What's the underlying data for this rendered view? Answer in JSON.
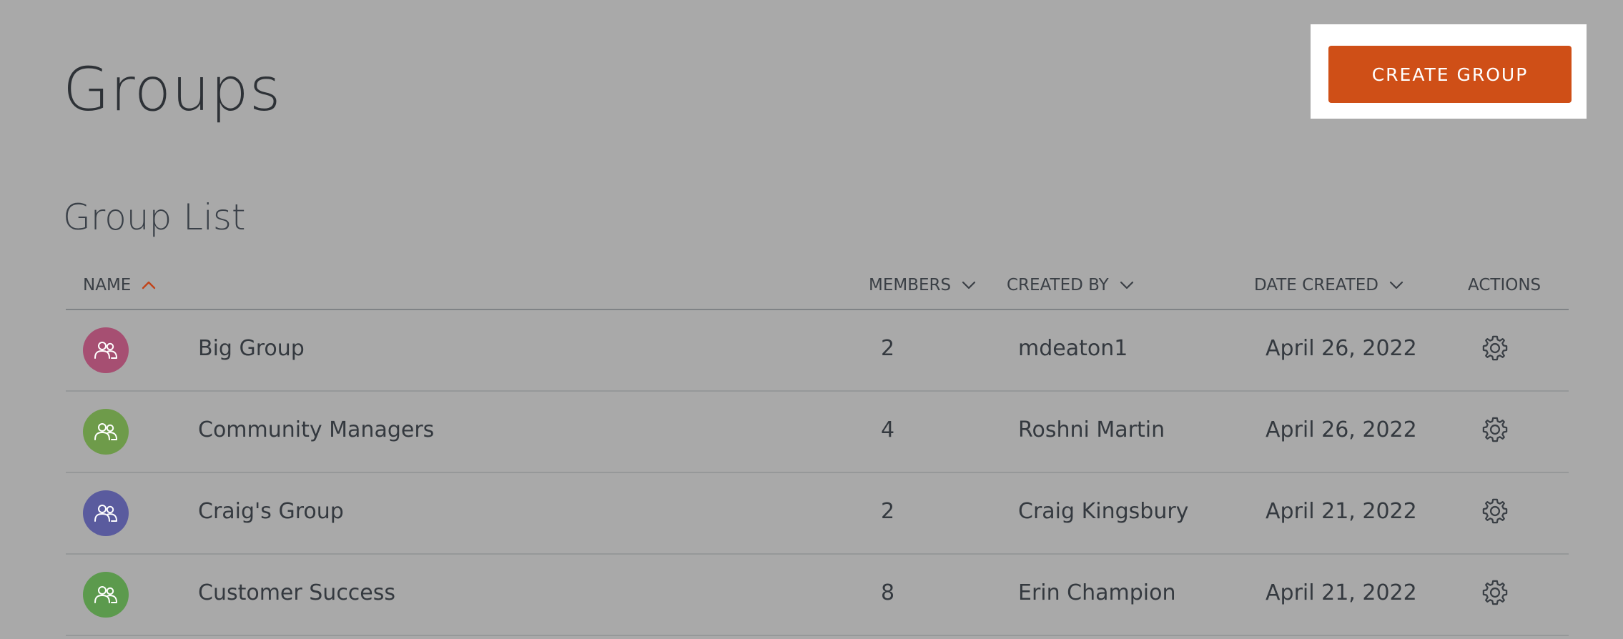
{
  "page": {
    "title": "Groups",
    "create_button_label": "CREATE GROUP",
    "section_title": "Group List"
  },
  "colors": {
    "background": "#a9a9a9",
    "accent": "#cf4f17",
    "sort_active": "#c1441a"
  },
  "table": {
    "columns": {
      "name": "NAME",
      "members": "MEMBERS",
      "created_by": "CREATED BY",
      "date_created": "DATE CREATED",
      "actions": "ACTIONS"
    },
    "sort": {
      "column": "name",
      "direction": "ascending"
    },
    "rows": [
      {
        "name": "Big Group",
        "members": "2",
        "created_by": "mdeaton1",
        "date_created": "April 26, 2022",
        "avatar_color": "#a64f72",
        "avatar_icon": "group-icon",
        "action_icon": "gear-icon"
      },
      {
        "name": "Community Managers",
        "members": "4",
        "created_by": "Roshni Martin",
        "date_created": "April 26, 2022",
        "avatar_color": "#6e9b4a",
        "avatar_icon": "group-icon",
        "action_icon": "gear-icon"
      },
      {
        "name": "Craig's Group",
        "members": "2",
        "created_by": "Craig Kingsbury",
        "date_created": "April 21, 2022",
        "avatar_color": "#5a5b9e",
        "avatar_icon": "group-icon",
        "action_icon": "gear-icon"
      },
      {
        "name": "Customer Success",
        "members": "8",
        "created_by": "Erin Champion",
        "date_created": "April 21, 2022",
        "avatar_color": "#5c9a4d",
        "avatar_icon": "group-icon",
        "action_icon": "gear-icon"
      }
    ]
  }
}
